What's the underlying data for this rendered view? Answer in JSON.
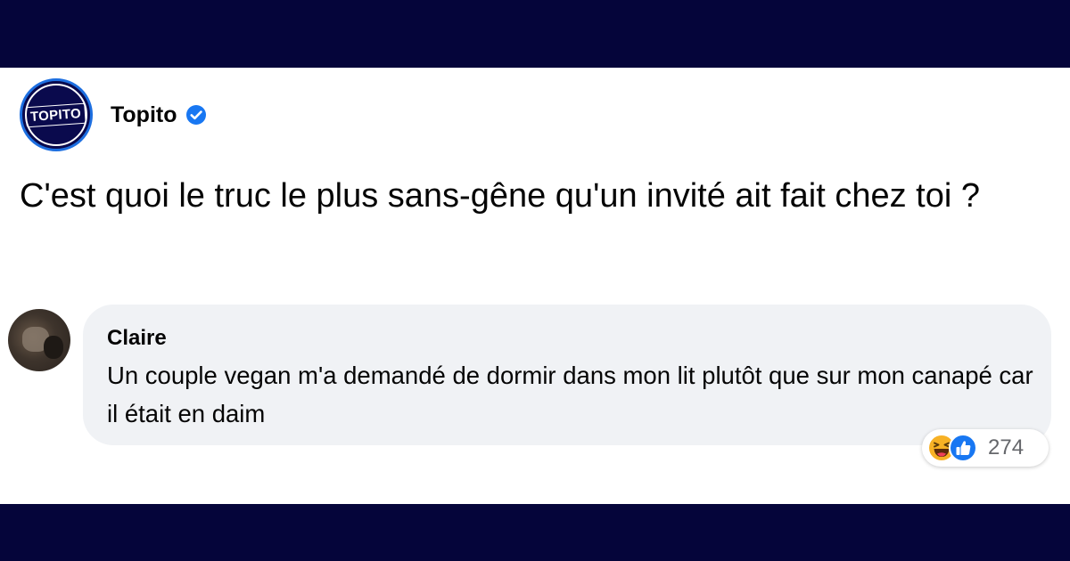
{
  "post": {
    "page_name": "Topito",
    "logo_text": "TOPITO",
    "verified": true,
    "text": "C'est quoi le truc le plus sans-gêne qu'un invité ait fait chez toi ?"
  },
  "comment": {
    "author": "Claire",
    "text": "Un couple vegan m'a demandé de dormir dans mon lit plutôt que sur mon canapé car il était en daim",
    "reactions": {
      "icons": [
        "haha-reaction-icon",
        "like-reaction-icon"
      ],
      "count": "274"
    }
  },
  "colors": {
    "band": "#05053a",
    "bubble": "#f0f2f5",
    "verified_blue": "#1877f2",
    "like_blue": "#1877f2",
    "haha_yellow": "#f7b125"
  }
}
